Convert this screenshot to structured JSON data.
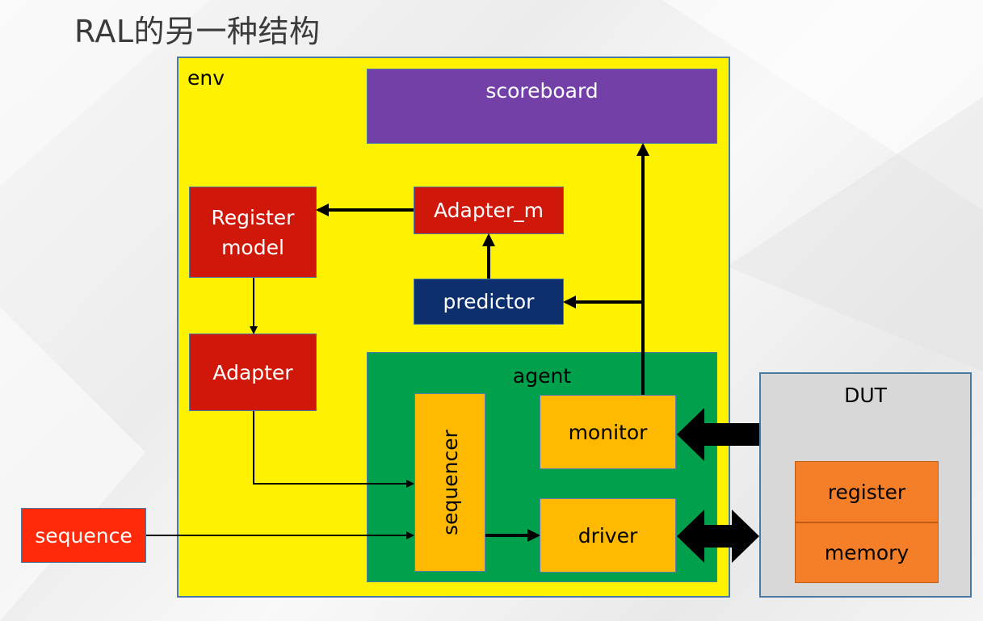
{
  "title": "RAL的另一种结构",
  "env": {
    "label": "env"
  },
  "scoreboard": {
    "label": "scoreboard"
  },
  "register_model": {
    "label": "Register\nmodel"
  },
  "adapter": {
    "label": "Adapter"
  },
  "adapter_m": {
    "label": "Adapter_m"
  },
  "predictor": {
    "label": "predictor"
  },
  "agent": {
    "label": "agent",
    "sequencer": {
      "label": "sequencer"
    },
    "monitor": {
      "label": "monitor"
    },
    "driver": {
      "label": "driver"
    }
  },
  "sequence": {
    "label": "sequence"
  },
  "dut": {
    "label": "DUT",
    "register": {
      "label": "register"
    },
    "memory": {
      "label": "memory"
    }
  },
  "colors": {
    "env": "#fff200",
    "scoreboard": "#7340a8",
    "red_block": "#d0180a",
    "predictor": "#0d2f6e",
    "agent": "#00a04c",
    "agent_block": "#ffb900",
    "sequence": "#ff2a0a",
    "dut": "#d8d8d8",
    "dut_block": "#f47f28"
  }
}
